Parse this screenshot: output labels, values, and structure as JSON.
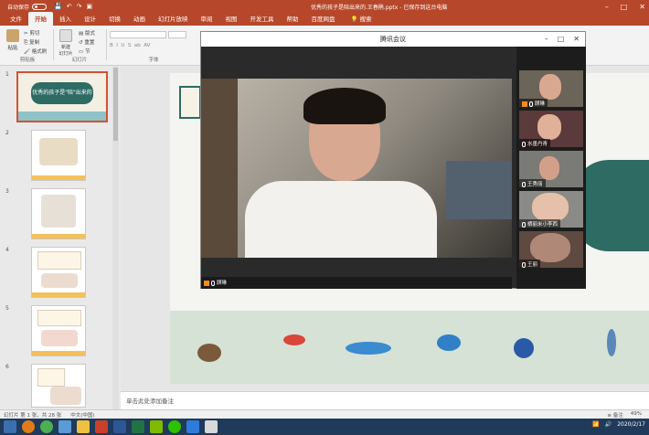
{
  "titlebar": {
    "autosave_label": "自动保存",
    "autosave_state": "关",
    "doc_title": "优秀的孩子是陪出来的.王春鹃.pptx - 已保存到这台电脑",
    "window_buttons": [
      "–",
      "□",
      "✕"
    ]
  },
  "ribbon_tabs": [
    "文件",
    "开始",
    "插入",
    "设计",
    "切换",
    "动画",
    "幻灯片放映",
    "审阅",
    "视图",
    "开发工具",
    "帮助",
    "百度网盘"
  ],
  "search_label": "搜索",
  "ribbon": {
    "paste": "粘贴",
    "cut": "剪切",
    "copy": "复制",
    "format_painter": "格式刷",
    "clipboard_group": "剪贴板",
    "new_slide": "新建\n幻灯片",
    "layout": "版式",
    "reset": "重置",
    "section": "节",
    "slides_group": "幻灯片",
    "font_group": "字体"
  },
  "slides": [
    {
      "num": "1",
      "active": true,
      "text": "优秀的孩子是\"陪\"出来的"
    },
    {
      "num": "2",
      "active": false,
      "text": ""
    },
    {
      "num": "3",
      "active": false,
      "text": ""
    },
    {
      "num": "4",
      "active": false,
      "text": ""
    },
    {
      "num": "5",
      "active": false,
      "text": ""
    },
    {
      "num": "6",
      "active": false,
      "text": ""
    }
  ],
  "meeting": {
    "title": "腾讯会议",
    "host_name": "顾琳",
    "participants": [
      {
        "name": "顾琳",
        "host": true
      },
      {
        "name": "水墨丹青"
      },
      {
        "name": "王秀丽"
      },
      {
        "name": "栖丽米小李西"
      },
      {
        "name": "王丽"
      }
    ]
  },
  "notes_placeholder": "单击此处添加备注",
  "statusbar": {
    "slide_info": "幻灯片 第 1 张，共 28 张",
    "language": "中文(中国)",
    "notes_btn": "备注",
    "zoom": "49%"
  },
  "taskbar": {
    "date": "2020/2/17"
  }
}
